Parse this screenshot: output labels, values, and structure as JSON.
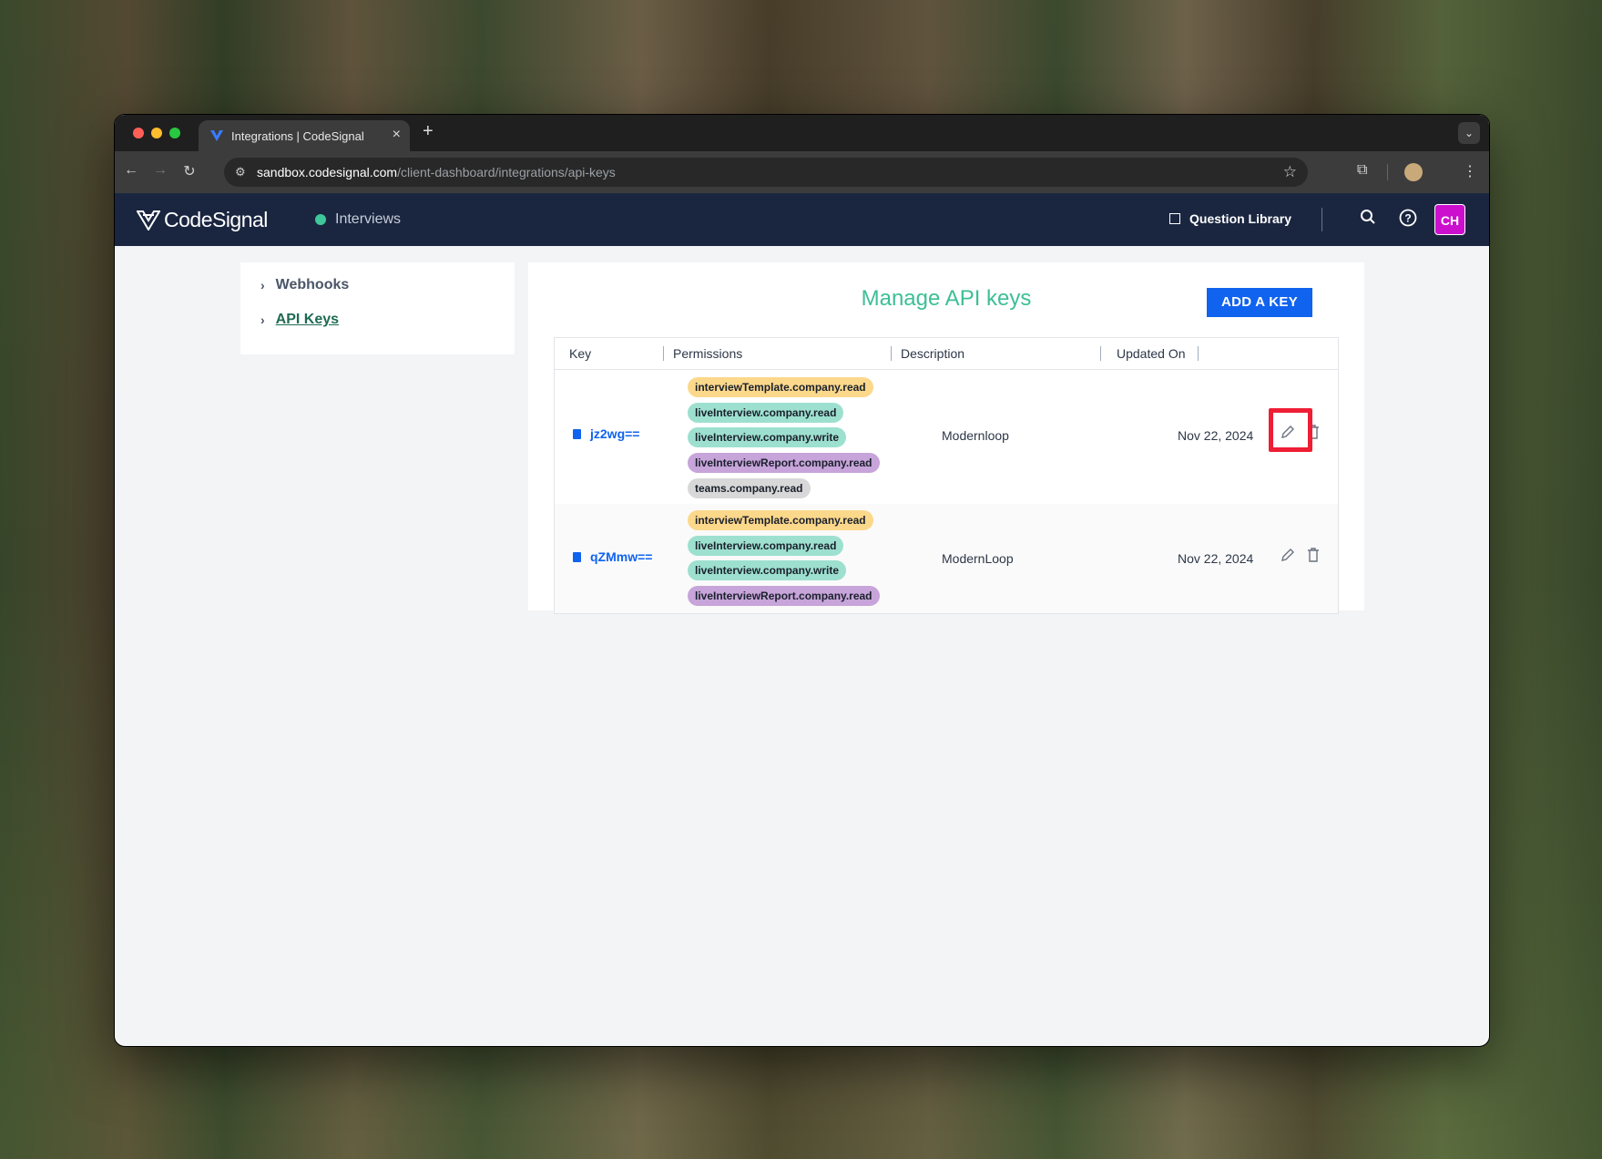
{
  "browser": {
    "tab_title": "Integrations | CodeSignal",
    "url_host": "sandbox.codesignal.com",
    "url_path": "/client-dashboard/integrations/api-keys"
  },
  "header": {
    "brand": "CodeSignal",
    "product": "Interviews",
    "question_library": "Question Library",
    "avatar_initials": "CH",
    "avatar_color": "#cc0fce"
  },
  "sidebar": {
    "items": [
      {
        "label": "Webhooks"
      },
      {
        "label": "API Keys"
      }
    ]
  },
  "main": {
    "title": "Manage API keys",
    "add_key_label": "ADD A KEY",
    "columns": [
      "Key",
      "Permissions",
      "Description",
      "Updated On"
    ],
    "rows": [
      {
        "key": "jz2wg==",
        "permissions": [
          "interviewTemplate.company.read",
          "liveInterview.company.read",
          "liveInterview.company.write",
          "liveInterviewReport.company.read",
          "teams.company.read"
        ],
        "description": "Modernloop",
        "updated_on": "Nov 22, 2024"
      },
      {
        "key": "qZMmw==",
        "permissions": [
          "interviewTemplate.company.read",
          "liveInterview.company.read",
          "liveInterview.company.write",
          "liveInterviewReport.company.read"
        ],
        "description": "ModernLoop",
        "updated_on": "Nov 22, 2024"
      }
    ]
  },
  "colors": {
    "header_bg": "#1a2640",
    "accent_title": "#3dbf95",
    "primary_button": "#1063ee",
    "highlight_box": "#ee1e35"
  }
}
